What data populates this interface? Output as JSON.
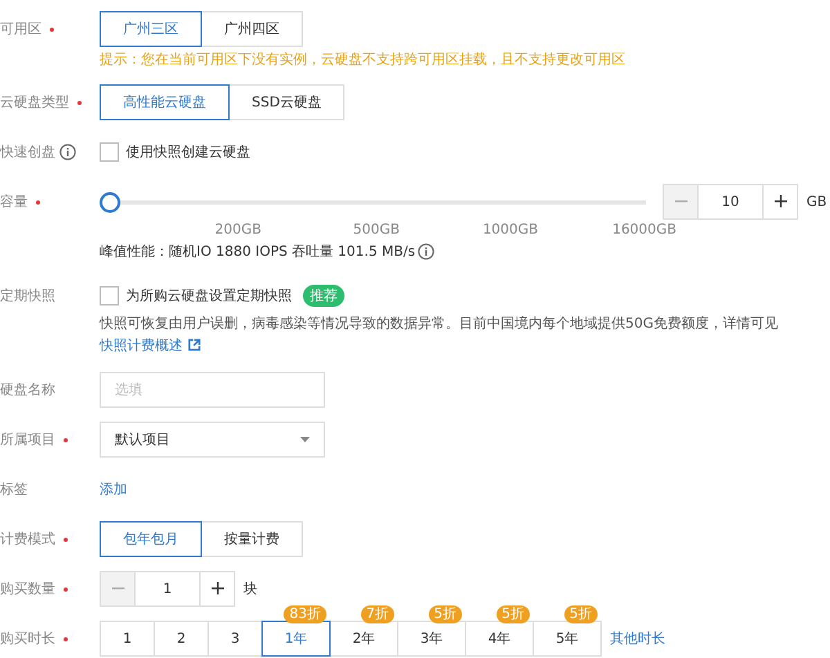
{
  "fields": [
    {
      "kind": "segmented",
      "label": "可用区",
      "required": true,
      "options": [
        {
          "label": "广州三区",
          "selected": true
        },
        {
          "label": "广州四区",
          "selected": false
        }
      ],
      "hint": "提示：您在当前可用区下没有实例，云硬盘不支持跨可用区挂载，且不支持更改可用区"
    },
    {
      "kind": "segmented",
      "label": "云硬盘类型",
      "required": true,
      "options": [
        {
          "label": "高性能云硬盘",
          "selected": true
        },
        {
          "label": "SSD云硬盘",
          "selected": false
        }
      ]
    },
    {
      "kind": "checkbox",
      "label": "快速创盘",
      "info": true,
      "text": "使用快照创建云硬盘",
      "checked": false
    },
    {
      "kind": "slider",
      "label": "容量",
      "required": true,
      "level": 0,
      "ticks": [
        "200GB",
        "500GB",
        "1000GB",
        "16000GB"
      ],
      "value": "10",
      "unit": "GB",
      "note": "峰值性能：随机IO 1880 IOPS 吞吐量 101.5 MB/s"
    },
    {
      "kind": "snapshot",
      "label": "定期快照",
      "text": "为所购云硬盘设置定期快照",
      "checked": false,
      "badge": "推荐",
      "description": "快照可恢复由用户误删，病毒感染等情况导致的数据异常。目前中国境内每个地域提供50G免费额度，详情可见",
      "link": "快照计费概述"
    },
    {
      "kind": "input",
      "label": "硬盘名称",
      "placeholder": "选填"
    },
    {
      "kind": "select",
      "label": "所属项目",
      "required": true,
      "value": "默认项目"
    },
    {
      "kind": "link",
      "label": "标签",
      "text": "添加"
    },
    {
      "kind": "segmented",
      "label": "计费模式",
      "required": true,
      "options": [
        {
          "label": "包年包月",
          "selected": true
        },
        {
          "label": "按量计费",
          "selected": false
        }
      ]
    },
    {
      "kind": "stepper",
      "label": "购买数量",
      "required": true,
      "value": "1",
      "unit": "块"
    },
    {
      "kind": "duration",
      "label": "购买时长",
      "required": true,
      "options": [
        {
          "label": "1",
          "selected": false
        },
        {
          "label": "2",
          "selected": false
        },
        {
          "label": "3",
          "selected": false
        },
        {
          "label": "1年",
          "selected": true,
          "badge": "83折"
        },
        {
          "label": "2年",
          "selected": false,
          "badge": "7折"
        },
        {
          "label": "3年",
          "selected": false,
          "badge": "5折"
        },
        {
          "label": "4年",
          "selected": false,
          "badge": "5折"
        },
        {
          "label": "5年",
          "selected": false,
          "badge": "5折"
        }
      ],
      "link": "其他时长"
    }
  ]
}
